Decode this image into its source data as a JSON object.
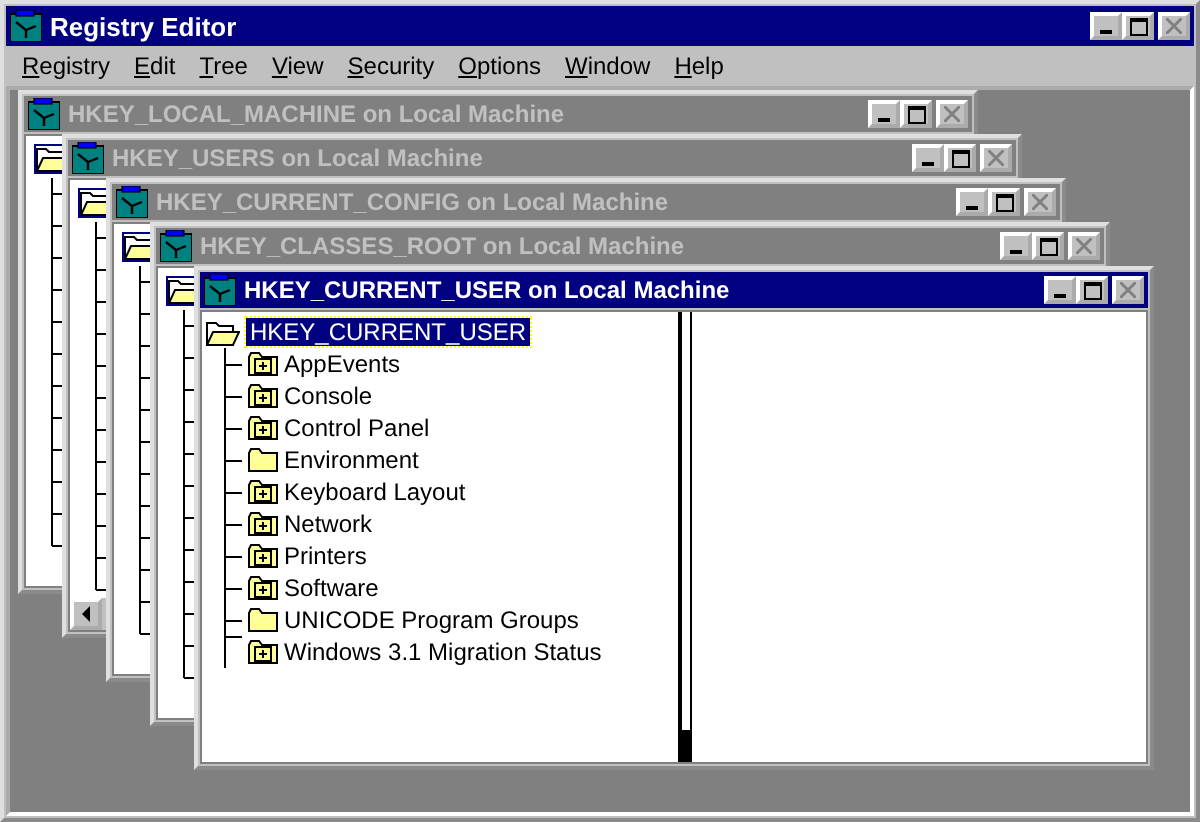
{
  "app": {
    "title": "Registry Editor"
  },
  "menu": [
    "Registry",
    "Edit",
    "Tree",
    "View",
    "Security",
    "Options",
    "Window",
    "Help"
  ],
  "windows": [
    {
      "title": "HKEY_LOCAL_MACHINE on Local Machine",
      "active": false
    },
    {
      "title": "HKEY_USERS on Local Machine",
      "active": false,
      "hscroll": true
    },
    {
      "title": "HKEY_CURRENT_CONFIG on Local Machine",
      "active": false
    },
    {
      "title": "HKEY_CLASSES_ROOT on Local Machine",
      "active": false
    },
    {
      "title": "HKEY_CURRENT_USER on Local Machine",
      "active": true,
      "tree": {
        "label": "HKEY_CURRENT_USER",
        "selected": true,
        "children": [
          {
            "label": "AppEvents",
            "expandable": true
          },
          {
            "label": "Console",
            "expandable": true
          },
          {
            "label": "Control Panel",
            "expandable": true
          },
          {
            "label": "Environment",
            "expandable": false
          },
          {
            "label": "Keyboard Layout",
            "expandable": true
          },
          {
            "label": "Network",
            "expandable": true
          },
          {
            "label": "Printers",
            "expandable": true
          },
          {
            "label": "Software",
            "expandable": true
          },
          {
            "label": "UNICODE Program Groups",
            "expandable": false
          },
          {
            "label": "Windows 3.1 Migration Status",
            "expandable": true
          }
        ]
      }
    }
  ]
}
